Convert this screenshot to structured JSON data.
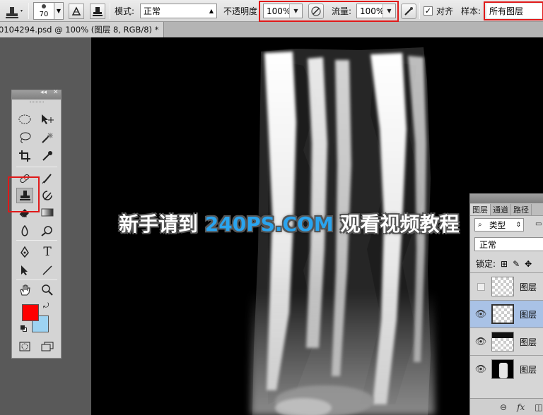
{
  "options_bar": {
    "brush_size": "70",
    "mode_label": "模式:",
    "mode_value": "正常",
    "opacity_label": "不透明度",
    "opacity_value": "100%",
    "flow_label": "流量:",
    "flow_value": "100%",
    "align_label": "对齐",
    "align_checked": true,
    "sample_label": "样本:",
    "sample_value": "所有图层"
  },
  "document_tab": {
    "title": "0104294.psd @ 100% (图层 8, RGB/8) *",
    "close": "×"
  },
  "watermark": {
    "prefix": "新手请到 ",
    "site": "240PS.COM",
    "suffix": " 观看视频教程"
  },
  "layers_panel": {
    "tabs": [
      "图层",
      "通道",
      "路径"
    ],
    "filter": "类型",
    "blend_mode": "正常",
    "lock_label": "锁定:",
    "layers": [
      {
        "name": "图层",
        "visible": false,
        "selected": false
      },
      {
        "name": "图层",
        "visible": true,
        "selected": true
      },
      {
        "name": "图层",
        "visible": true,
        "selected": false
      },
      {
        "name": "图层",
        "visible": true,
        "selected": false
      }
    ],
    "footer_icons": [
      "link-icon",
      "fx-icon"
    ]
  },
  "toolbox": {
    "foreground_color": "#ff0000",
    "background_color": "#9dd3f2",
    "active_tool": "clone-stamp-tool"
  },
  "highlight_color": "#e01a1a"
}
